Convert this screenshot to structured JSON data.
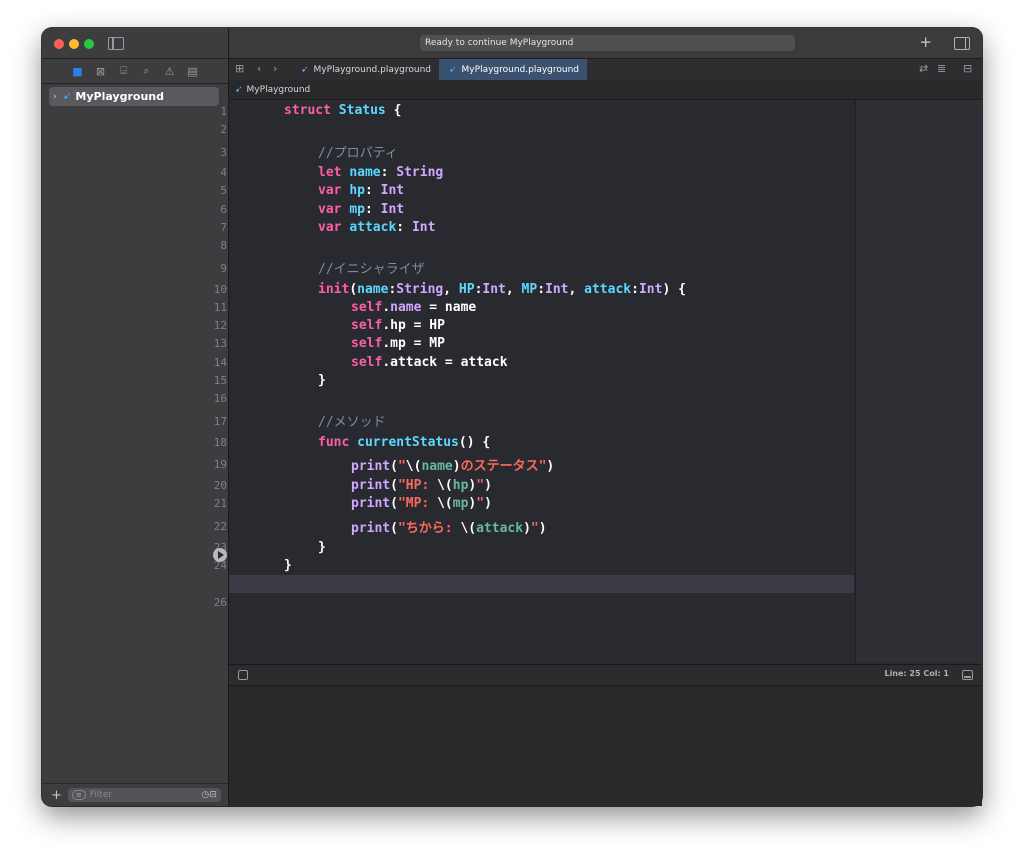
{
  "toolbar": {
    "status_text": "Ready to continue MyPlayground",
    "add_icon": "plus-icon",
    "inspector_icon": "inspector-toggle-icon"
  },
  "sidebar": {
    "navigator_icons": [
      "folder-icon",
      "source-control-icon",
      "symbol-icon",
      "search-icon",
      "warning-icon",
      "breakpoint-icon"
    ],
    "project": {
      "name": "MyPlayground",
      "icon": "swift-icon"
    },
    "filter_placeholder": "Filter"
  },
  "tabs": [
    {
      "label": "MyPlayground.playground",
      "active": false
    },
    {
      "label": "MyPlayground.playground",
      "active": true
    }
  ],
  "jumpbar": {
    "path": "MyPlayground"
  },
  "editor": {
    "current_line": 25,
    "lines": [
      {
        "n": "1"
      },
      {
        "n": "2"
      },
      {
        "n": "3"
      },
      {
        "n": "4"
      },
      {
        "n": "5"
      },
      {
        "n": "6"
      },
      {
        "n": "7"
      },
      {
        "n": "8"
      },
      {
        "n": "9"
      },
      {
        "n": "10"
      },
      {
        "n": "11"
      },
      {
        "n": "12"
      },
      {
        "n": "13"
      },
      {
        "n": "14"
      },
      {
        "n": "15"
      },
      {
        "n": "16"
      },
      {
        "n": "17"
      },
      {
        "n": "18"
      },
      {
        "n": "19"
      },
      {
        "n": "20"
      },
      {
        "n": "21"
      },
      {
        "n": "22"
      },
      {
        "n": "23"
      },
      {
        "n": "24"
      },
      {
        "n": "26"
      }
    ],
    "code": {
      "l1": [
        "struct",
        " ",
        "Status",
        " {"
      ],
      "l3": "//プロパティ",
      "l4": [
        "let",
        " ",
        "name",
        ": ",
        "String"
      ],
      "l5": [
        "var",
        " ",
        "hp",
        ": ",
        "Int"
      ],
      "l6": [
        "var",
        " ",
        "mp",
        ": ",
        "Int"
      ],
      "l7": [
        "var",
        " ",
        "attack",
        ": ",
        "Int"
      ],
      "l9": "//イニシャライザ",
      "l10": [
        "init",
        "(",
        "name",
        ":",
        "String",
        ", ",
        "HP",
        ":",
        "Int",
        ", ",
        "MP",
        ":",
        "Int",
        ", ",
        "attack",
        ":",
        "Int",
        ") {"
      ],
      "l11": [
        "self",
        ".",
        "name",
        " = name"
      ],
      "l12": [
        "self",
        ".hp = HP"
      ],
      "l13": [
        "self",
        ".mp = MP"
      ],
      "l14": [
        "self",
        ".attack = attack"
      ],
      "l15": "}",
      "l17": "//メソッド",
      "l18": [
        "func",
        " ",
        "currentStatus",
        "() {"
      ],
      "l19": [
        "print",
        "(",
        "\"",
        "\\(",
        "name",
        ")",
        "のステータス\"",
        ")"
      ],
      "l20": [
        "print",
        "(",
        "\"HP: ",
        "\\(",
        "hp",
        ")",
        "\"",
        ")"
      ],
      "l21": [
        "print",
        "(",
        "\"MP: ",
        "\\(",
        "mp",
        ")",
        "\"",
        ")"
      ],
      "l22": [
        "print",
        "(",
        "\"ちから: ",
        "\\(",
        "attack",
        ")",
        "\"",
        ")"
      ],
      "l23": "}",
      "l24": "}"
    }
  },
  "debug": {
    "line_col": "Line: 25  Col: 1"
  },
  "colors": {
    "keyword": "#fc5fa3",
    "type": "#5dd8ff",
    "property": "#d0a8ff",
    "comment": "#7f8c98",
    "string": "#fc6a5d",
    "interpolation": "#67b7a4",
    "active_tab": "#3b5170"
  }
}
